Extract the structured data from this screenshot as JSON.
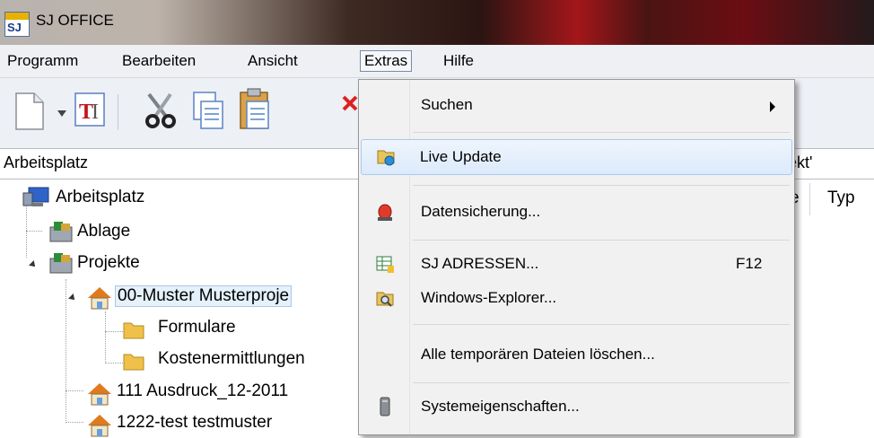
{
  "window": {
    "title": "SJ OFFICE",
    "icon_text": "SJ"
  },
  "menubar": [
    "Programm",
    "Bearbeiten",
    "Ansicht",
    "Extras",
    "Hilfe"
  ],
  "address": {
    "left": "Arbeitsplatz",
    "right": "ekt'"
  },
  "list_header": {
    "col_e": "e",
    "col_typ": "Typ"
  },
  "tree": {
    "root": "Arbeitsplatz",
    "ablage": "Ablage",
    "projekte": "Projekte",
    "muster": "00-Muster Musterproje",
    "formulare": "Formulare",
    "kosten": "Kostenermittlungen",
    "p111": "111 Ausdruck_12-2011",
    "p1222": "1222-test testmuster"
  },
  "extras_menu": {
    "suchen": "Suchen",
    "live_update": "Live Update",
    "datensicherung": "Datensicherung...",
    "adressen": "SJ ADRESSEN...",
    "adressen_shortcut": "F12",
    "explorer": "Windows-Explorer...",
    "temp": "Alle temporären Dateien löschen...",
    "system": "Systemeigenschaften..."
  },
  "icons": {
    "new": "new-document-icon",
    "text": "text-tool-icon",
    "cut": "scissors-icon",
    "copy": "copy-icon",
    "paste": "paste-icon",
    "delete": "delete-icon"
  }
}
